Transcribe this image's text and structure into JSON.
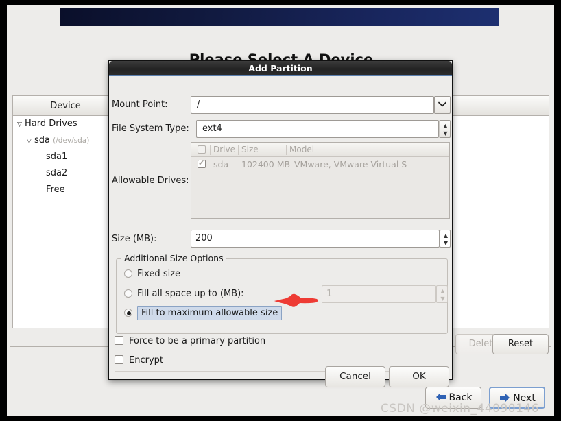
{
  "background": {
    "page_title": "Please Select A Device",
    "tree": {
      "header": "Device",
      "items": [
        {
          "label": "Hard Drives",
          "sub": "",
          "indent": 0,
          "expander": "▽"
        },
        {
          "label": "sda",
          "sub": "(/dev/sda)",
          "indent": 1,
          "expander": "▽"
        },
        {
          "label": "sda1",
          "sub": "",
          "indent": 2,
          "expander": ""
        },
        {
          "label": "sda2",
          "sub": "",
          "indent": 2,
          "expander": ""
        },
        {
          "label": "Free",
          "sub": "",
          "indent": 2,
          "expander": ""
        }
      ]
    },
    "action_buttons": {
      "delete_label": "Delete",
      "reset_label": "Reset"
    },
    "nav": {
      "back_label": "Back",
      "next_label": "Next",
      "back_icon": "arrow-left-icon",
      "next_icon": "arrow-right-icon"
    }
  },
  "dialog": {
    "title": "Add Partition",
    "mount_point": {
      "label": "Mount Point:",
      "value": "/",
      "dropdown_icon": "chevron-down-icon"
    },
    "file_system_type": {
      "label": "File System Type:",
      "value": "ext4",
      "spinner_icon": "spinner-updown-icon"
    },
    "allowable_drives": {
      "label": "Allowable Drives:",
      "columns": [
        "",
        "Drive",
        "Size",
        "Model"
      ],
      "rows": [
        {
          "checked": true,
          "drive": "sda",
          "size": "102400 MB",
          "model": "VMware, VMware Virtual S"
        }
      ]
    },
    "size_mb": {
      "label": "Size (MB):",
      "value": "200",
      "spinner_icon": "spinner-updown-icon"
    },
    "additional_size_options": {
      "legend": "Additional Size Options",
      "options": [
        {
          "label": "Fixed size",
          "selected": false
        },
        {
          "label": "Fill all space up to (MB):",
          "selected": false
        },
        {
          "label": "Fill to maximum allowable size",
          "selected": true,
          "focused": true
        }
      ],
      "fill_up_to_value": "1",
      "fill_up_to_disabled": true
    },
    "checkboxes": [
      {
        "label": "Force to be a primary partition",
        "checked": false
      },
      {
        "label": "Encrypt",
        "checked": false
      }
    ],
    "buttons": {
      "cancel_label": "Cancel",
      "ok_label": "OK"
    }
  },
  "annotation": {
    "arrow_color": "#ee3b34",
    "points_at": "Fill to maximum allowable size"
  },
  "watermark": "CSDN @weixin_44090146",
  "colors": {
    "banner": "#152458",
    "dialog_titlebar": "#2a2a2a",
    "focus_blue": "#8ba3c4",
    "nav_arrow_blue": "#2f62b4"
  }
}
